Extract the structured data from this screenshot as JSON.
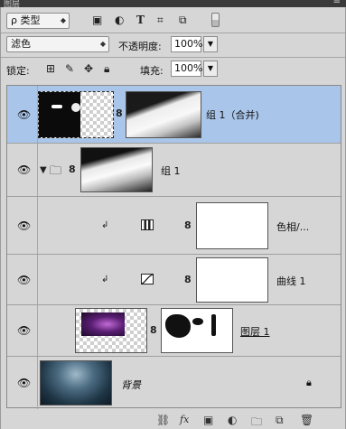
{
  "panel": {
    "tab": "图层"
  },
  "filter": {
    "kind": "类型",
    "search_symbol": "ρ"
  },
  "blend": {
    "mode": "滤色",
    "opacity_label": "不透明度:",
    "opacity_value": "100%"
  },
  "lock": {
    "label": "锁定:",
    "fill_label": "填充:",
    "fill_value": "100%"
  },
  "layers": [
    {
      "name": "组 1（合并)",
      "selected": true
    },
    {
      "name": "组 1"
    },
    {
      "name": "色相/..."
    },
    {
      "name": "曲线 1"
    },
    {
      "name": "图层 1"
    },
    {
      "name": "背景"
    }
  ],
  "footer_icons": [
    "link-icon",
    "fx-icon",
    "mask-icon",
    "adjustment-icon",
    "folder-icon",
    "new-layer-icon",
    "trash-icon"
  ]
}
